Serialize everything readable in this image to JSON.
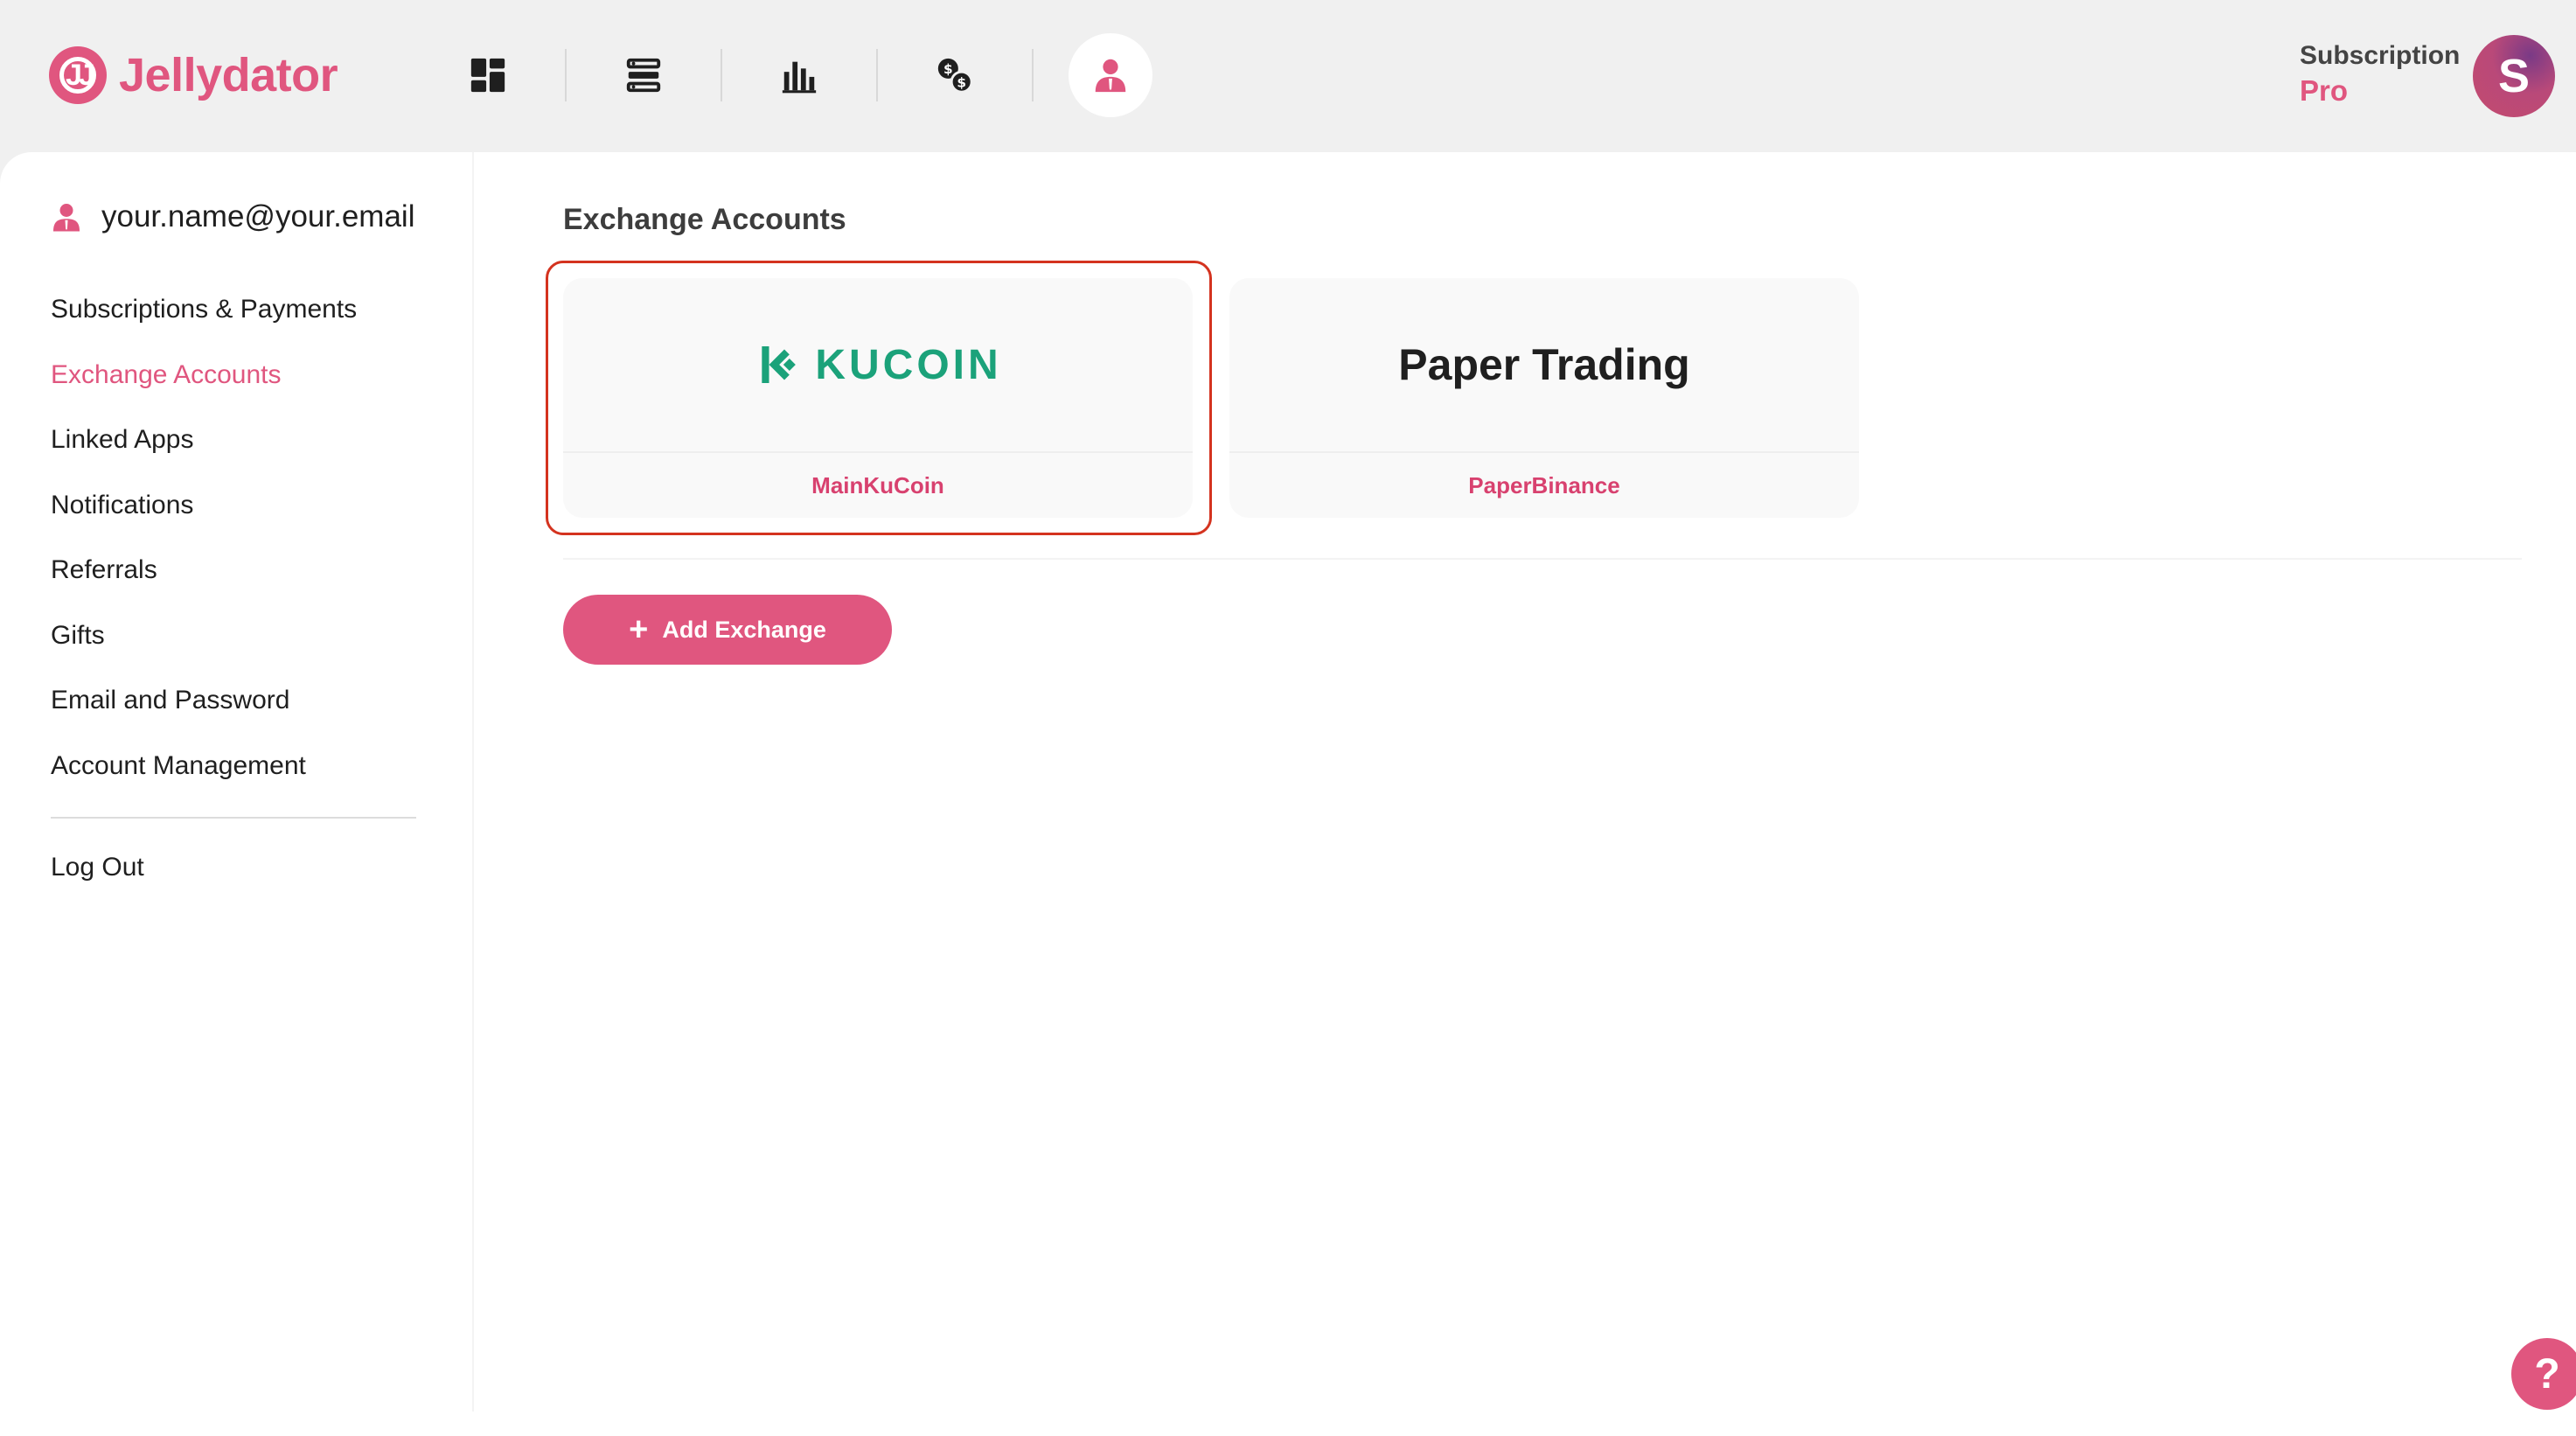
{
  "brand": {
    "name": "Jellydator",
    "mark": "JJ"
  },
  "colors": {
    "accent": "#e0567f",
    "kucoin": "#1ba27a",
    "highlight": "#d4331f"
  },
  "nav": [
    {
      "icon": "dashboard-icon"
    },
    {
      "icon": "bots-list-icon"
    },
    {
      "icon": "bar-chart-icon"
    },
    {
      "icon": "currency-exchange-icon"
    },
    {
      "icon": "account-icon",
      "active": true
    }
  ],
  "subscription": {
    "label": "Subscription",
    "value": "Pro"
  },
  "avatar": {
    "initial": "S"
  },
  "sidebar": {
    "email": "your.name@your.email",
    "items": [
      {
        "label": "Subscriptions & Payments"
      },
      {
        "label": "Exchange Accounts",
        "active": true
      },
      {
        "label": "Linked Apps"
      },
      {
        "label": "Notifications"
      },
      {
        "label": "Referrals"
      },
      {
        "label": "Gifts"
      },
      {
        "label": "Email and Password"
      },
      {
        "label": "Account Management"
      }
    ],
    "logout": "Log Out"
  },
  "main": {
    "title": "Exchange Accounts",
    "accounts": [
      {
        "logo_text": "KUCOIN",
        "name": "MainKuCoin"
      },
      {
        "logo_text": "Paper Trading",
        "name": "PaperBinance"
      }
    ],
    "add_button": "Add Exchange"
  },
  "help": {
    "label": "?"
  }
}
